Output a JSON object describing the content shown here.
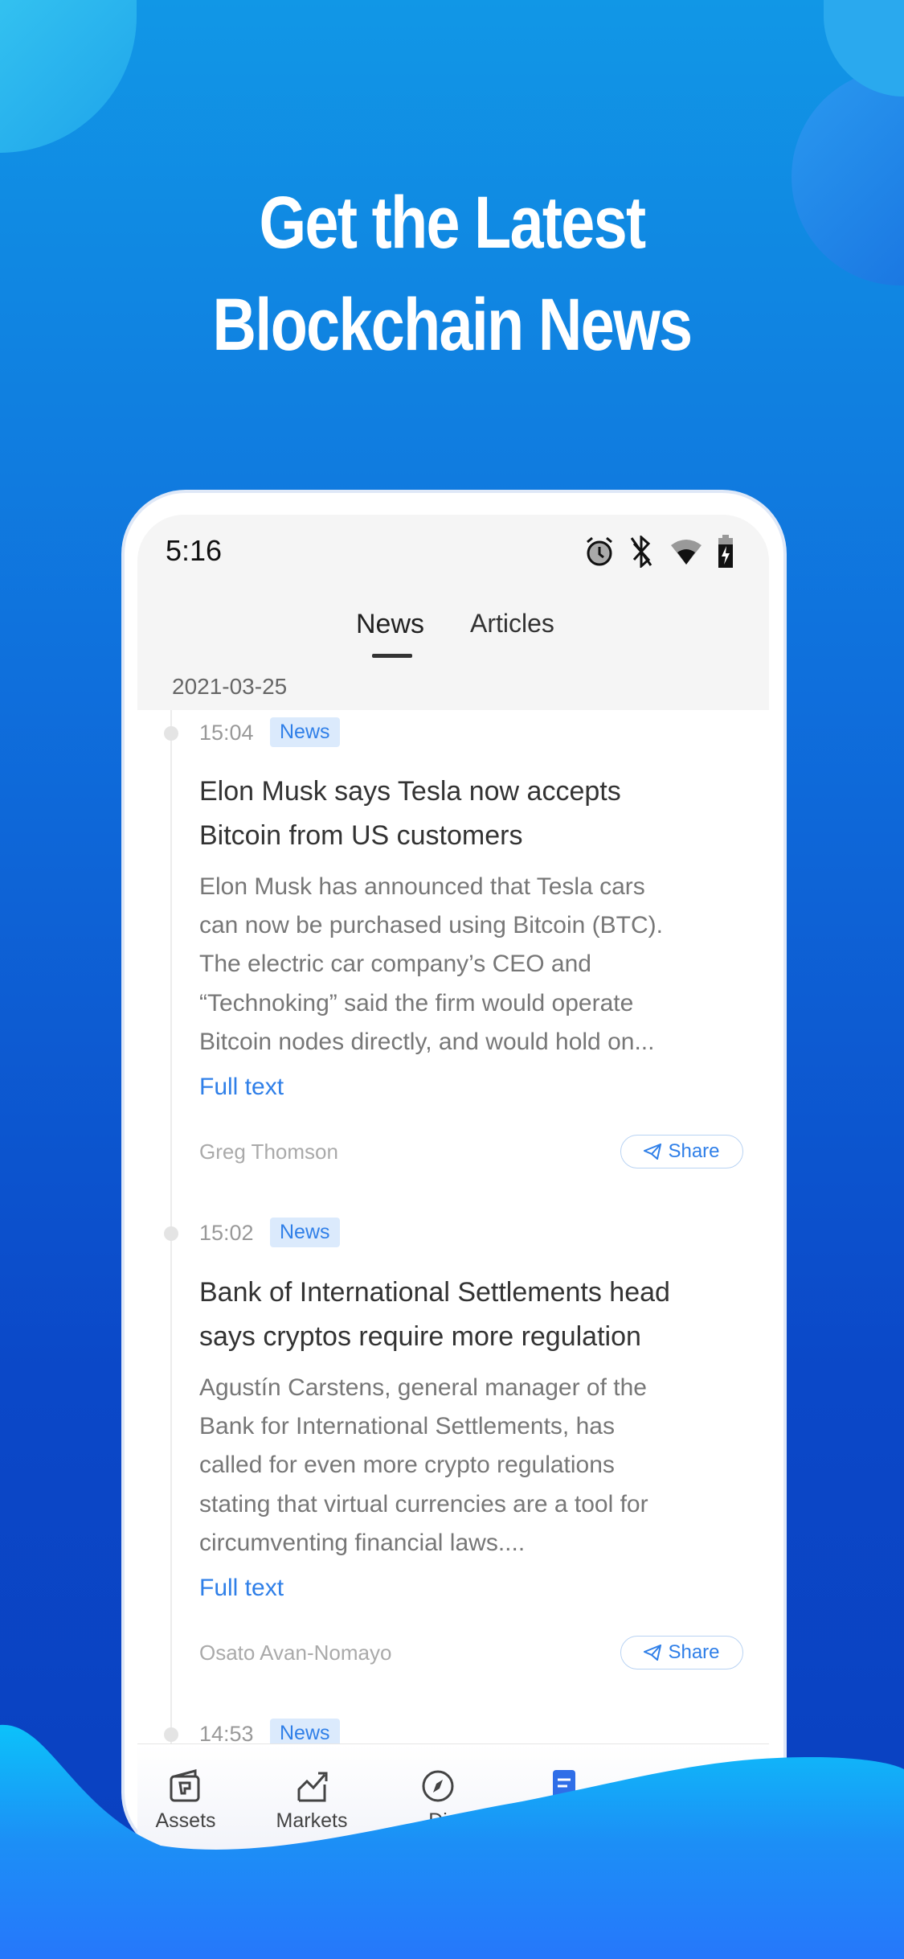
{
  "headline": [
    "Get the Latest",
    "Blockchain News"
  ],
  "status_bar": {
    "time": "5:16",
    "icons": [
      "alarm-icon",
      "bluetooth-off-icon",
      "wifi-icon",
      "battery-charging-icon"
    ]
  },
  "tabs": [
    {
      "label": "News",
      "active": true
    },
    {
      "label": "Articles",
      "active": false
    }
  ],
  "date": "2021-03-25",
  "news": [
    {
      "time": "15:04",
      "badge": "News",
      "title": [
        "Elon Musk says Tesla now accepts",
        "Bitcoin from US customers"
      ],
      "body": [
        "Elon Musk has announced that Tesla cars",
        "can now be purchased using Bitcoin (BTC).",
        "The electric car company’s CEO and",
        "“Technoking” said the firm would operate",
        "Bitcoin nodes directly, and would hold on..."
      ],
      "full_text": "Full text",
      "author": "Greg Thomson",
      "share": "Share"
    },
    {
      "time": "15:02",
      "badge": "News",
      "title": [
        "Bank of International Settlements head",
        "says cryptos require more regulation"
      ],
      "body": [
        "Agustín Carstens, general manager of the",
        "Bank for International Settlements, has",
        "called for even more crypto regulations",
        "stating that virtual currencies are a tool for",
        "circumventing financial laws...."
      ],
      "full_text": "Full text",
      "author": "Osato Avan-Nomayo",
      "share": "Share"
    },
    {
      "time": "14:53",
      "badge": "News"
    }
  ],
  "bottom_nav": [
    {
      "label": "Assets",
      "icon": "wallet-icon"
    },
    {
      "label": "Markets",
      "icon": "chart-icon"
    },
    {
      "label": "Di",
      "icon": "compass-icon"
    },
    {
      "label": "",
      "icon": "news-icon",
      "active": true
    }
  ],
  "colors": {
    "accent": "#2f7fe8",
    "badge_bg": "#dbeafc"
  }
}
